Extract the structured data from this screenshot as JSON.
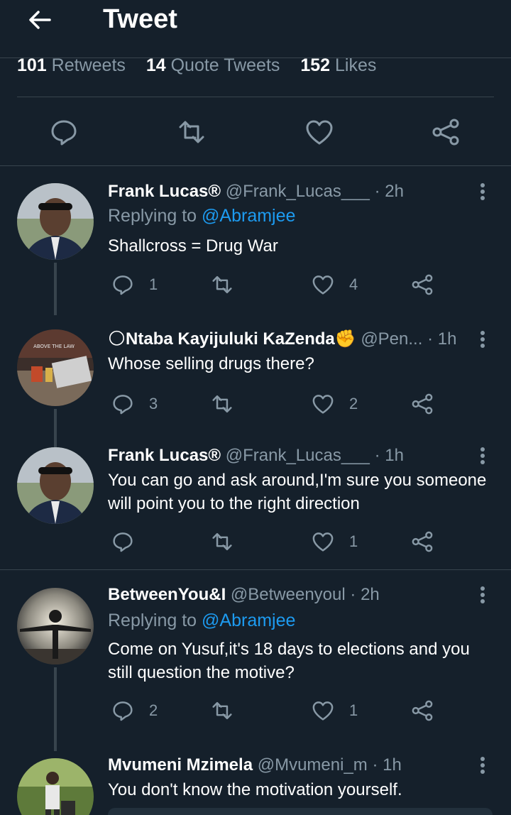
{
  "header": {
    "title": "Tweet"
  },
  "stats": [
    {
      "count": "101",
      "label": "Retweets"
    },
    {
      "count": "14",
      "label": "Quote Tweets"
    },
    {
      "count": "152",
      "label": "Likes"
    }
  ],
  "colors": {
    "background": "#15202b",
    "accent": "#1d9bf0",
    "muted": "#8899a6",
    "divider": "#38444d"
  },
  "tweets": [
    {
      "name": "Frank Lucas®",
      "handle": "@Frank_Lucas___",
      "time": "2h",
      "replying_prefix": "Replying to",
      "replying_to": "@Abramjee",
      "text": "Shallcross = Drug War",
      "replies": "1",
      "retweets": "",
      "likes": "4"
    },
    {
      "name": "🌕Ntaba Kayijuluki KaZenda✊",
      "handle": "@Pen...",
      "time": "1h",
      "text": "Whose selling drugs there?",
      "replies": "3",
      "retweets": "",
      "likes": "2",
      "avatar_text": "ABOVE THE LAW"
    },
    {
      "name": "Frank Lucas®",
      "handle": "@Frank_Lucas___",
      "time": "1h",
      "text": "You can go and ask around,I'm sure you someone will point you to the right direction",
      "replies": "",
      "retweets": "",
      "likes": "1"
    },
    {
      "name": "BetweenYou&I",
      "handle": "@Betweenyoul",
      "time": "2h",
      "replying_prefix": "Replying to",
      "replying_to": "@Abramjee",
      "text": "Come on Yusuf,it's 18 days to elections and you still question the motive?",
      "replies": "2",
      "retweets": "",
      "likes": "1"
    },
    {
      "name": "Mvumeni Mzimela",
      "handle": "@Mvumeni_m",
      "time": "1h",
      "text": "You don't know the motivation yourself."
    }
  ]
}
